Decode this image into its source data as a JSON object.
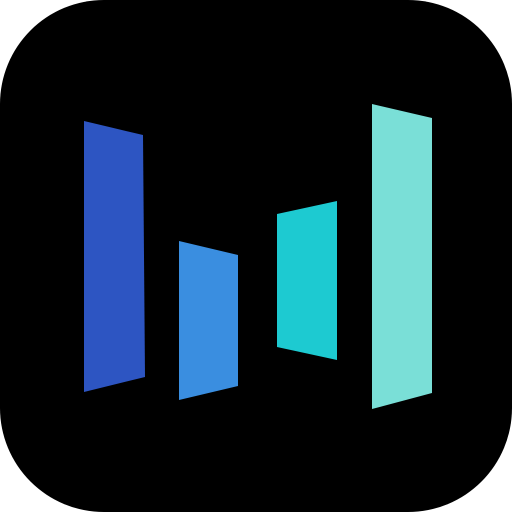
{
  "app_icon": {
    "icon_name": "bar-logo-icon",
    "background_color": "#000000",
    "bar_colors": [
      "#2D55C2",
      "#3A8EE0",
      "#1DCAD1",
      "#7ADFD7"
    ]
  }
}
